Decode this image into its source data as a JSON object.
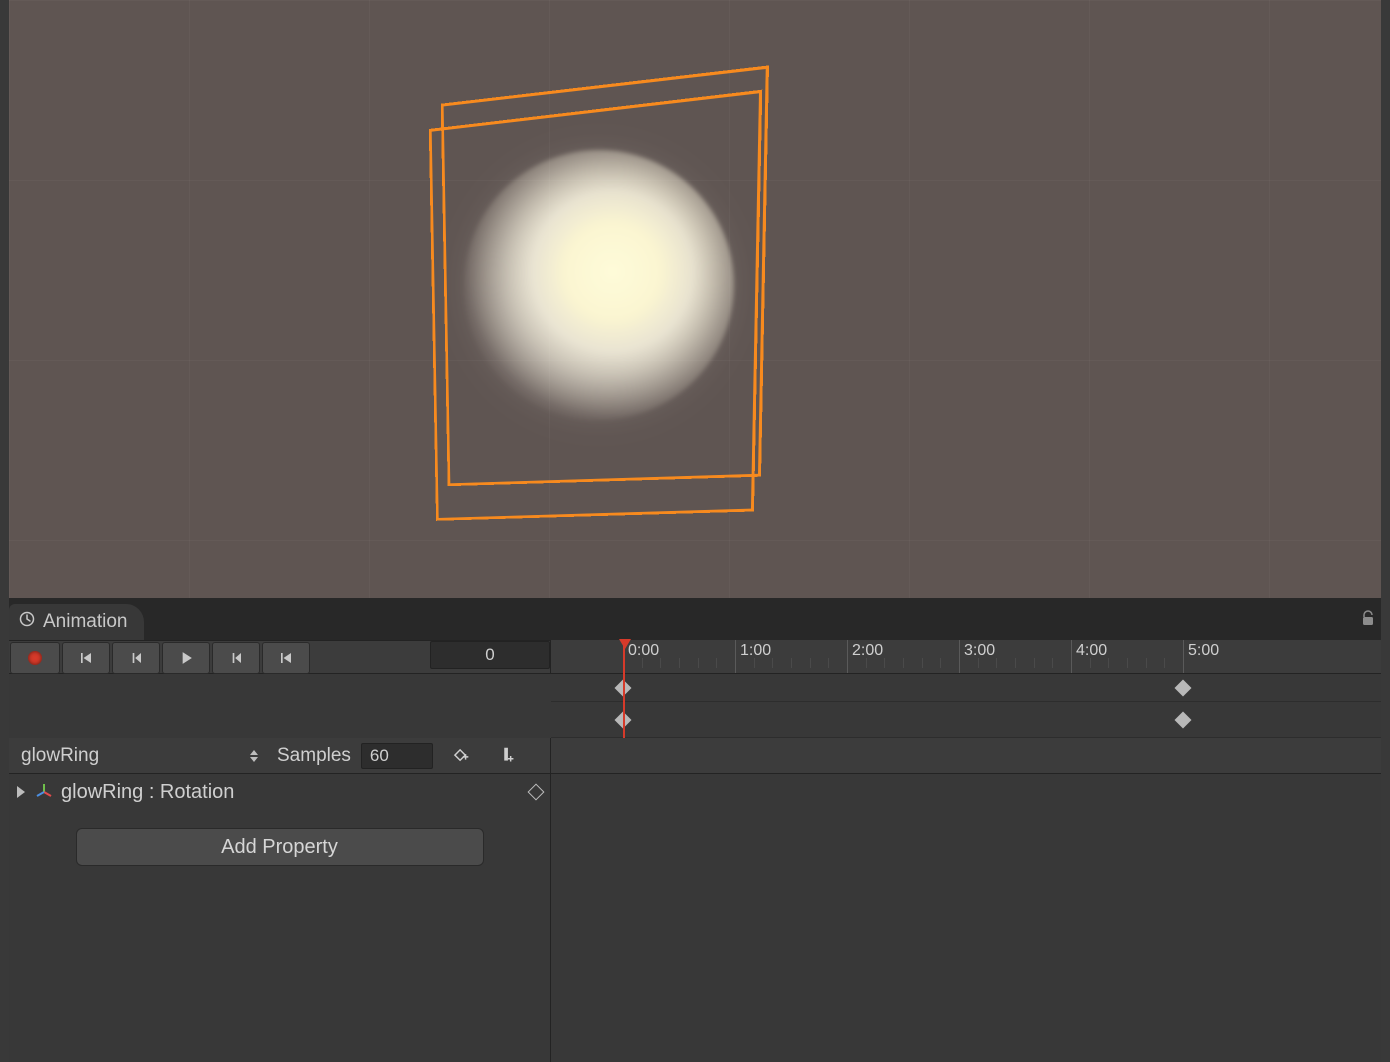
{
  "tab": {
    "label": "Animation"
  },
  "toolbar": {
    "current_frame": "0"
  },
  "clip": {
    "name": "glowRing"
  },
  "samples": {
    "label": "Samples",
    "value": "60"
  },
  "property": {
    "name": "glowRing : Rotation"
  },
  "add_property": {
    "label": "Add Property"
  },
  "colors": {
    "accent_record": "#d63a2a",
    "selection": "#f78a1e"
  },
  "timeline": {
    "start": 0,
    "end": 300,
    "labels": [
      "0:00",
      "1:00",
      "2:00",
      "3:00",
      "4:00",
      "5:00"
    ],
    "playhead_frame": 0,
    "keyframes": [
      0,
      300
    ]
  }
}
